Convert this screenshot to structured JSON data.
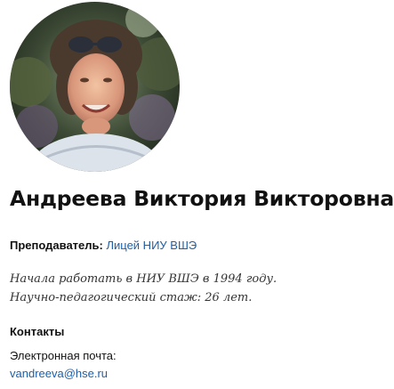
{
  "profile": {
    "photo_alt": "",
    "name": "Андреева Виктория Викторовна",
    "role_label": "Преподаватель:",
    "role_link": "Лицей НИУ ВШЭ",
    "started": "Начала работать в НИУ ВШЭ в 1994 году.",
    "experience": "Научно-педагогический стаж: 26 лет."
  },
  "contacts": {
    "title": "Контакты",
    "email_label": "Электронная почта:",
    "email": "vandreeva@hse.ru"
  },
  "colors": {
    "link": "#1d5fa8",
    "text": "#111111"
  }
}
